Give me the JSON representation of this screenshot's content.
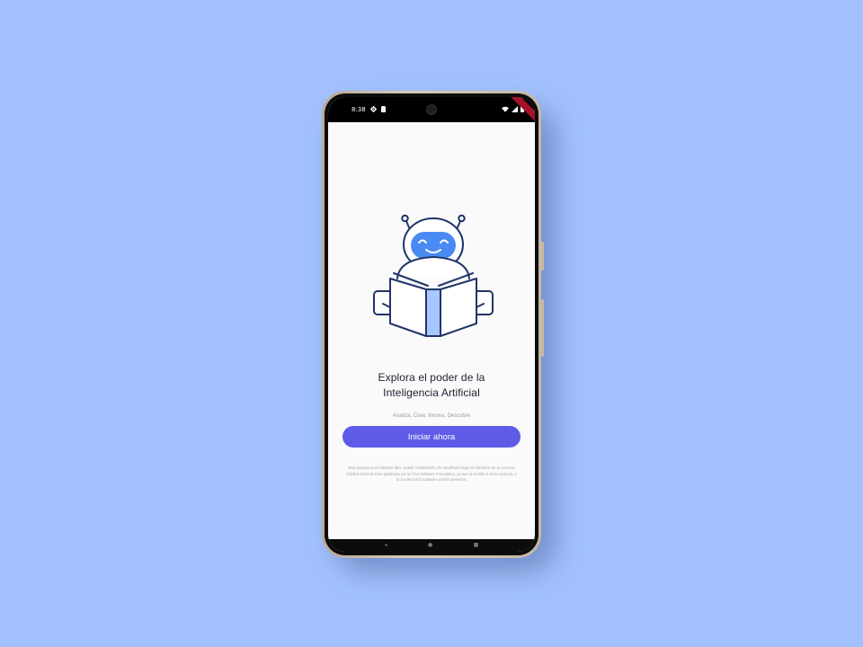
{
  "status_bar": {
    "time": "8:38",
    "left_icons": [
      "settings-icon",
      "sim-icon"
    ],
    "right_icons": [
      "wifi-icon",
      "signal-icon",
      "battery-icon"
    ]
  },
  "onboarding": {
    "illustration": "robot-reading-book",
    "headline_line1": "Explora el poder de la",
    "headline_line2": "Inteligencia Artificial",
    "tagline": "Analiza, Crea, Innova, Descubre",
    "cta_label": "Iniciar ahora",
    "disclaimer": "Este programa es software libre: puede redistribuirlo y/o modificarlo bajo los términos de la Licencia Pública General GNU publicada por la Free Software Foundation, ya sea la versión 3 de la Licencia, o (a su elección) cualquier versión posterior."
  },
  "nav_bar": {
    "items": [
      "back",
      "home",
      "recents"
    ]
  },
  "colors": {
    "background": "#a2c1fc",
    "accent": "#5e5ce6",
    "robot_outline": "#1f3568",
    "robot_face": "#4a8af4",
    "book_spine": "#a8c6ff"
  }
}
